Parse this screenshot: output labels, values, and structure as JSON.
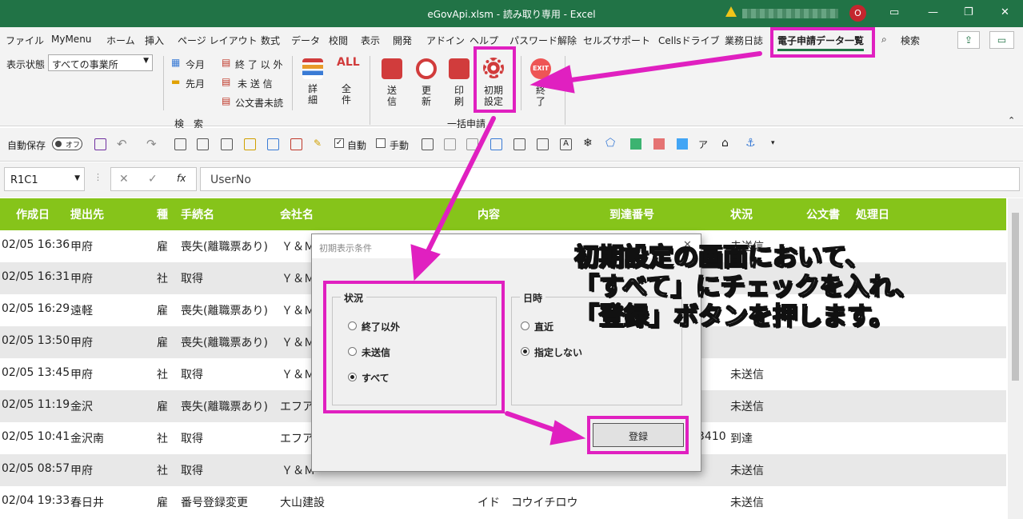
{
  "titlebar": {
    "title": "eGovApi.xlsm  -  読み取り専用  -  Excel",
    "avatar": "O"
  },
  "menu": [
    "ファイル",
    "MyMenu",
    "ホーム",
    "挿入",
    "ページ レイアウト",
    "数式",
    "データ",
    "校閲",
    "表示",
    "開発",
    "アドイン",
    "ヘルプ",
    "パスワード解除",
    "セルズサポート",
    "Cellsドライブ",
    "業務日誌",
    "電子申請データ一覧"
  ],
  "menu_search": "検索",
  "ribbon": {
    "filter_label": "表示状態",
    "filter_value": "すべての事業所",
    "today": "今月",
    "prevmonth": "先月",
    "done_other": "終 了 以 外",
    "unsent": "未 送 信",
    "unread": "公文書未読",
    "detail": "詳細",
    "all": "全件",
    "send": "送信",
    "update": "更新",
    "print": "印刷",
    "init": "初期設定",
    "exit": "終了",
    "group_search": "検　索",
    "group_bulk": "一括申請"
  },
  "qat": {
    "autosave": "自動保存",
    "toggle": "オフ",
    "auto": "自動",
    "manual": "手動"
  },
  "formula": {
    "namebox": "R1C1",
    "fx": "fx",
    "value": "UserNo"
  },
  "columns": [
    "作成日",
    "提出先",
    "種",
    "手続名",
    "会社名",
    "内容",
    "到達番号",
    "状況",
    "公文書",
    "処理日"
  ],
  "rows": [
    {
      "date": "02/05 16:36",
      "dest": "甲府",
      "kind": "雇",
      "proc": "喪失(離職票あり)",
      "company": "Ｙ＆Ｍ",
      "num": "",
      "status": "未送信"
    },
    {
      "date": "02/05 16:31",
      "dest": "甲府",
      "kind": "社",
      "proc": "取得",
      "company": "Ｙ＆Ｍ",
      "num": "",
      "status": ""
    },
    {
      "date": "02/05 16:29",
      "dest": "遠軽",
      "kind": "雇",
      "proc": "喪失(離職票あり)",
      "company": "Ｙ＆Ｍ",
      "num": "",
      "status": ""
    },
    {
      "date": "02/05 13:50",
      "dest": "甲府",
      "kind": "雇",
      "proc": "喪失(離職票あり)",
      "company": "Ｙ＆Ｍ",
      "num": "",
      "status": ""
    },
    {
      "date": "02/05 13:45",
      "dest": "甲府",
      "kind": "社",
      "proc": "取得",
      "company": "Ｙ＆Ｍ",
      "num": "",
      "status": "未送信"
    },
    {
      "date": "02/05 11:19",
      "dest": "金沢",
      "kind": "雇",
      "proc": "喪失(離職票あり)",
      "company": "エフア",
      "num": "",
      "status": "未送信"
    },
    {
      "date": "02/05 10:41",
      "dest": "金沢南",
      "kind": "社",
      "proc": "取得",
      "company": "エフア",
      "num": "3410",
      "status": "到達"
    },
    {
      "date": "02/05 08:57",
      "dest": "甲府",
      "kind": "社",
      "proc": "取得",
      "company": "Ｙ＆Ｍ",
      "num": "",
      "status": "未送信"
    },
    {
      "date": "02/04 19:33",
      "dest": "春日井",
      "kind": "雇",
      "proc": "番号登録変更",
      "company": "大山建設",
      "num": "",
      "status": "未送信",
      "content": "イド　コウイチロウ"
    }
  ],
  "dialog": {
    "title": "初期表示条件",
    "status_group": "状況",
    "opt1": "終了以外",
    "opt2": "未送信",
    "opt3": "すべて",
    "date_group": "日時",
    "opt4": "直近",
    "opt5": "指定しない",
    "register": "登録"
  },
  "annotation": [
    "初期設定の画面において、",
    "「すべて」にチェックを入れ、",
    "「登録」ボタンを押します。"
  ],
  "colors": {
    "excel_green": "#217346",
    "header_green": "#86c41a",
    "highlight": "#e020c0"
  }
}
